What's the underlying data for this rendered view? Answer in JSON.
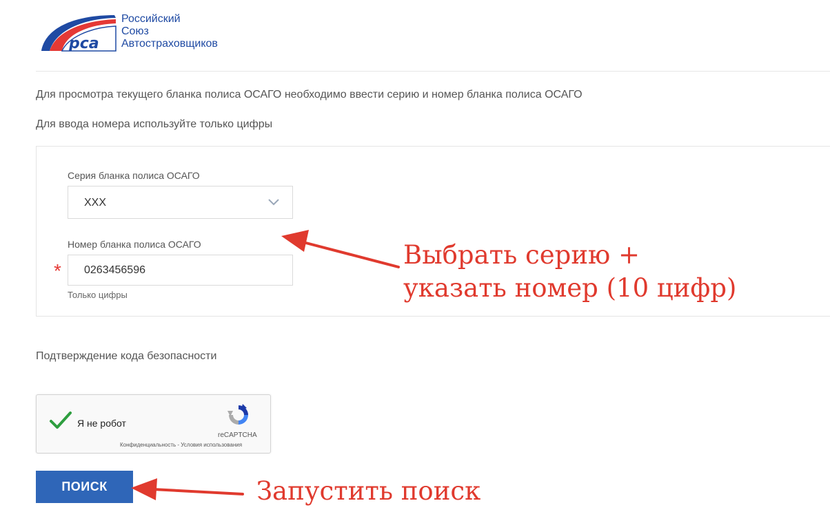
{
  "logo": {
    "mark_text": "рса",
    "line1": "Российский",
    "line2": "Союз",
    "line3": "Автостраховщиков"
  },
  "info": {
    "line1": "Для просмотра текущего бланка полиса ОСАГО необходимо ввести серию и номер бланка полиса ОСАГО",
    "line2": "Для ввода номера используйте только цифры"
  },
  "form": {
    "series_label": "Серия бланка полиса ОСАГО",
    "series_value": "ХХХ",
    "number_label": "Номер бланка полиса ОСАГО",
    "number_value": "0263456596",
    "required_mark": "*",
    "number_hint": "Только цифры"
  },
  "security": {
    "label": "Подтверждение кода безопасности",
    "recaptcha_text": "Я не робот",
    "recaptcha_brand": "reCAPTCHA",
    "recaptcha_links": "Конфиденциальность - Условия использования"
  },
  "search_button": "ПОИСК",
  "annotations": {
    "top_line1": "Выбрать серию +",
    "top_line2": "указать номер (10 цифр)",
    "bottom": "Запустить поиск",
    "color": "#e03a2e"
  },
  "colors": {
    "brand_blue": "#1f4aa3",
    "button_blue": "#2f66b8",
    "check_green": "#2e9e3f"
  }
}
